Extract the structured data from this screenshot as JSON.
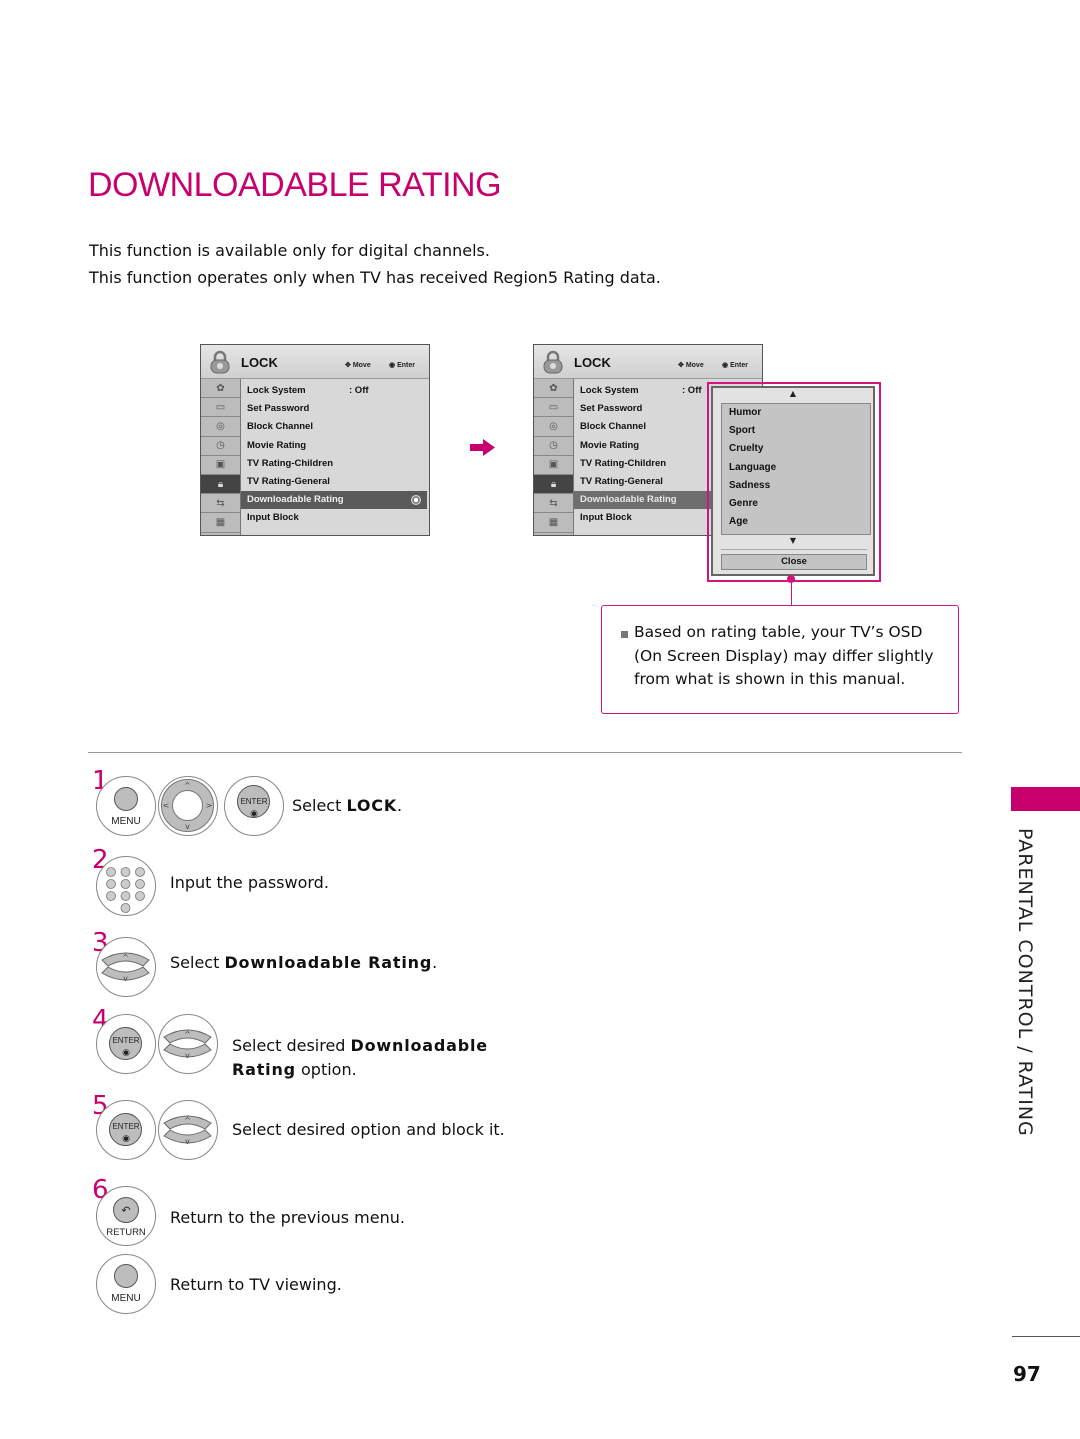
{
  "page": {
    "title": "DOWNLOADABLE RATING",
    "intro": [
      "This function is available only for digital channels.",
      "This function operates only when TV has received Region5 Rating data."
    ],
    "section_label": "PARENTAL CONTROL / RATING",
    "page_number": "97",
    "accent_color": "#c8006e"
  },
  "osd_left": {
    "header": "LOCK",
    "hint_move": "Move",
    "hint_enter": "Enter",
    "side_icons": [
      "setup-icon",
      "picture-icon",
      "audio-icon",
      "time-icon",
      "option-icon",
      "lock-icon",
      "input-icon",
      "usb-icon"
    ],
    "items": [
      {
        "label": "Lock System",
        "value": ": Off"
      },
      {
        "label": "Set Password",
        "value": ""
      },
      {
        "label": "Block Channel",
        "value": ""
      },
      {
        "label": "Movie Rating",
        "value": ""
      },
      {
        "label": "TV Rating-Children",
        "value": ""
      },
      {
        "label": "TV Rating-General",
        "value": ""
      },
      {
        "label": "Downloadable Rating",
        "value": "",
        "selected": true
      },
      {
        "label": "Input Block",
        "value": ""
      }
    ]
  },
  "osd_right": {
    "header": "LOCK",
    "hint_move": "Move",
    "hint_enter": "Enter",
    "items": [
      {
        "label": "Lock System",
        "value": ": Off"
      },
      {
        "label": "Set Password",
        "value": ""
      },
      {
        "label": "Block Channel",
        "value": ""
      },
      {
        "label": "Movie Rating",
        "value": ""
      },
      {
        "label": "TV Rating-Children",
        "value": ""
      },
      {
        "label": "TV Rating-General",
        "value": ""
      },
      {
        "label": "Downloadable Rating",
        "value": "",
        "selected": true
      },
      {
        "label": "Input Block",
        "value": ""
      }
    ],
    "popup": {
      "options": [
        "Humor",
        "Sport",
        "Cruelty",
        "Language",
        "Sadness",
        "Genre",
        "Age"
      ],
      "up_arrow": "▲",
      "down_arrow": "▼",
      "close_label": "Close"
    }
  },
  "note": {
    "text": "Based on rating table, your TV’s OSD (On Screen Display) may differ slightly from what is shown in this manual."
  },
  "steps": [
    {
      "num": "1",
      "text_pre": "Select ",
      "text_bold": "LOCK",
      "text_post": ".",
      "buttons": [
        "MENU",
        "nav-pad",
        "ENTER"
      ]
    },
    {
      "num": "2",
      "text_pre": "Input the password.",
      "text_bold": "",
      "text_post": "",
      "buttons": [
        "number-pad"
      ]
    },
    {
      "num": "3",
      "text_pre": "Select ",
      "text_bold": "Downloadable Rating",
      "text_post": ".",
      "buttons": [
        "up-down"
      ]
    },
    {
      "num": "4",
      "text_pre": "Select desired ",
      "text_bold": "Downloadable",
      "text_bold2": "Rating",
      "text_post": " option.",
      "buttons": [
        "ENTER",
        "up-down"
      ]
    },
    {
      "num": "5",
      "text_pre": "Select desired option and block it.",
      "text_bold": "",
      "text_post": "",
      "buttons": [
        "ENTER",
        "up-down"
      ]
    },
    {
      "num": "6",
      "text_pre": "Return to the previous menu.",
      "text_bold": "",
      "text_post": "",
      "buttons": [
        "RETURN"
      ]
    },
    {
      "num": "",
      "text_pre": "Return to TV viewing.",
      "text_bold": "",
      "text_post": "",
      "buttons": [
        "MENU"
      ]
    }
  ],
  "buttons": {
    "menu_label": "MENU",
    "enter_label": "ENTER",
    "return_label": "RETURN",
    "keypad": [
      "1",
      "2",
      "3",
      "4",
      "5",
      "6",
      "7",
      "8",
      "9",
      "0"
    ]
  }
}
